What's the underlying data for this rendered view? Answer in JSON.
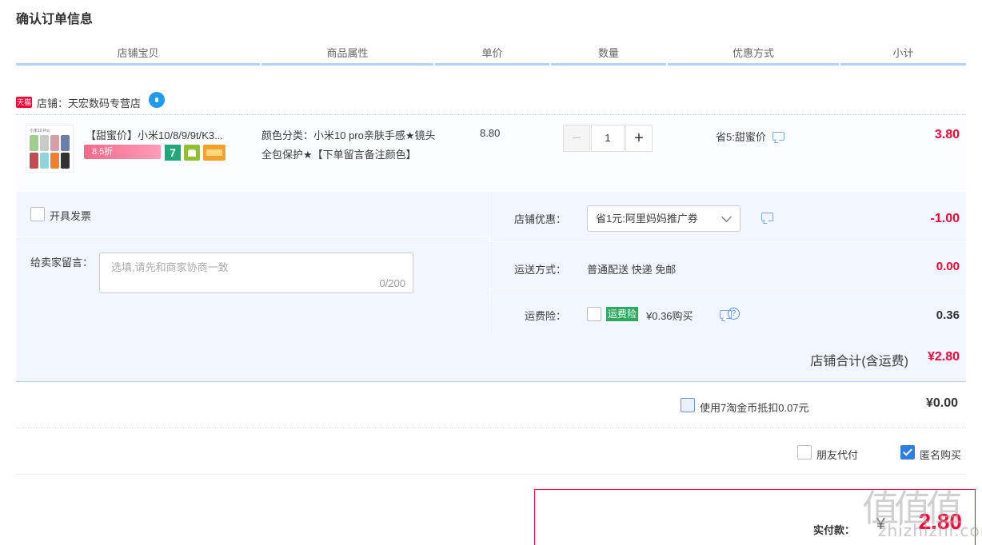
{
  "page_title": "确认订单信息",
  "columns": [
    "店铺宝贝",
    "商品属性",
    "单价",
    "数量",
    "优惠方式",
    "小计"
  ],
  "shop": {
    "badge": "天猫",
    "label": "店铺：天宏数码专营店"
  },
  "item": {
    "thumb_caption": "小米10 Pro",
    "title": "【甜蜜价】小米10/8/9/9t/K3...",
    "promo_badge": "8.5折",
    "badge_seven": "7",
    "attributes": "颜色分类：小米10 pro亲肤手感★镜头全包保护★【下单留言备注颜色】",
    "unit_price": "8.80",
    "quantity": "1",
    "minus": "−",
    "plus": "+",
    "discount": "省5:甜蜜价",
    "subtotal": "3.80"
  },
  "invoice": {
    "label": "开具发票"
  },
  "remark": {
    "label": "给卖家留言：",
    "placeholder": "选填,请先和商家协商一致",
    "counter": "0/200"
  },
  "shop_discount": {
    "label": "店铺优惠：",
    "selected": "省1元:阿里妈妈推广券",
    "value": "-1.00"
  },
  "shipping": {
    "label": "运送方式：",
    "text": "普通配送 快递 免邮",
    "value": "0.00"
  },
  "insurance": {
    "label": "运费险：",
    "badge": "运费险",
    "text": "¥0.36购买",
    "help": "?",
    "value": "0.36"
  },
  "shop_total": {
    "label": "店铺合计(含运费)",
    "value": "¥2.80"
  },
  "coins": {
    "label": "使用7淘金币抵扣0.07元",
    "value": "¥0.00"
  },
  "pay_options": {
    "friend_pay": "朋友代付",
    "anonymous": "匿名购买"
  },
  "final": {
    "label": "实付款：",
    "yen": "¥",
    "value": "2.80"
  },
  "watermark": {
    "glyphs": "值值值",
    "text": "zhizhizhi.com"
  },
  "colors": {
    "accent_red": "#ff0036",
    "header_line": "#b2d1ff",
    "panel_bg": "#f2f7ff",
    "checkbox_blue": "#2f7de1",
    "insurance_green": "#2eaa5e"
  }
}
